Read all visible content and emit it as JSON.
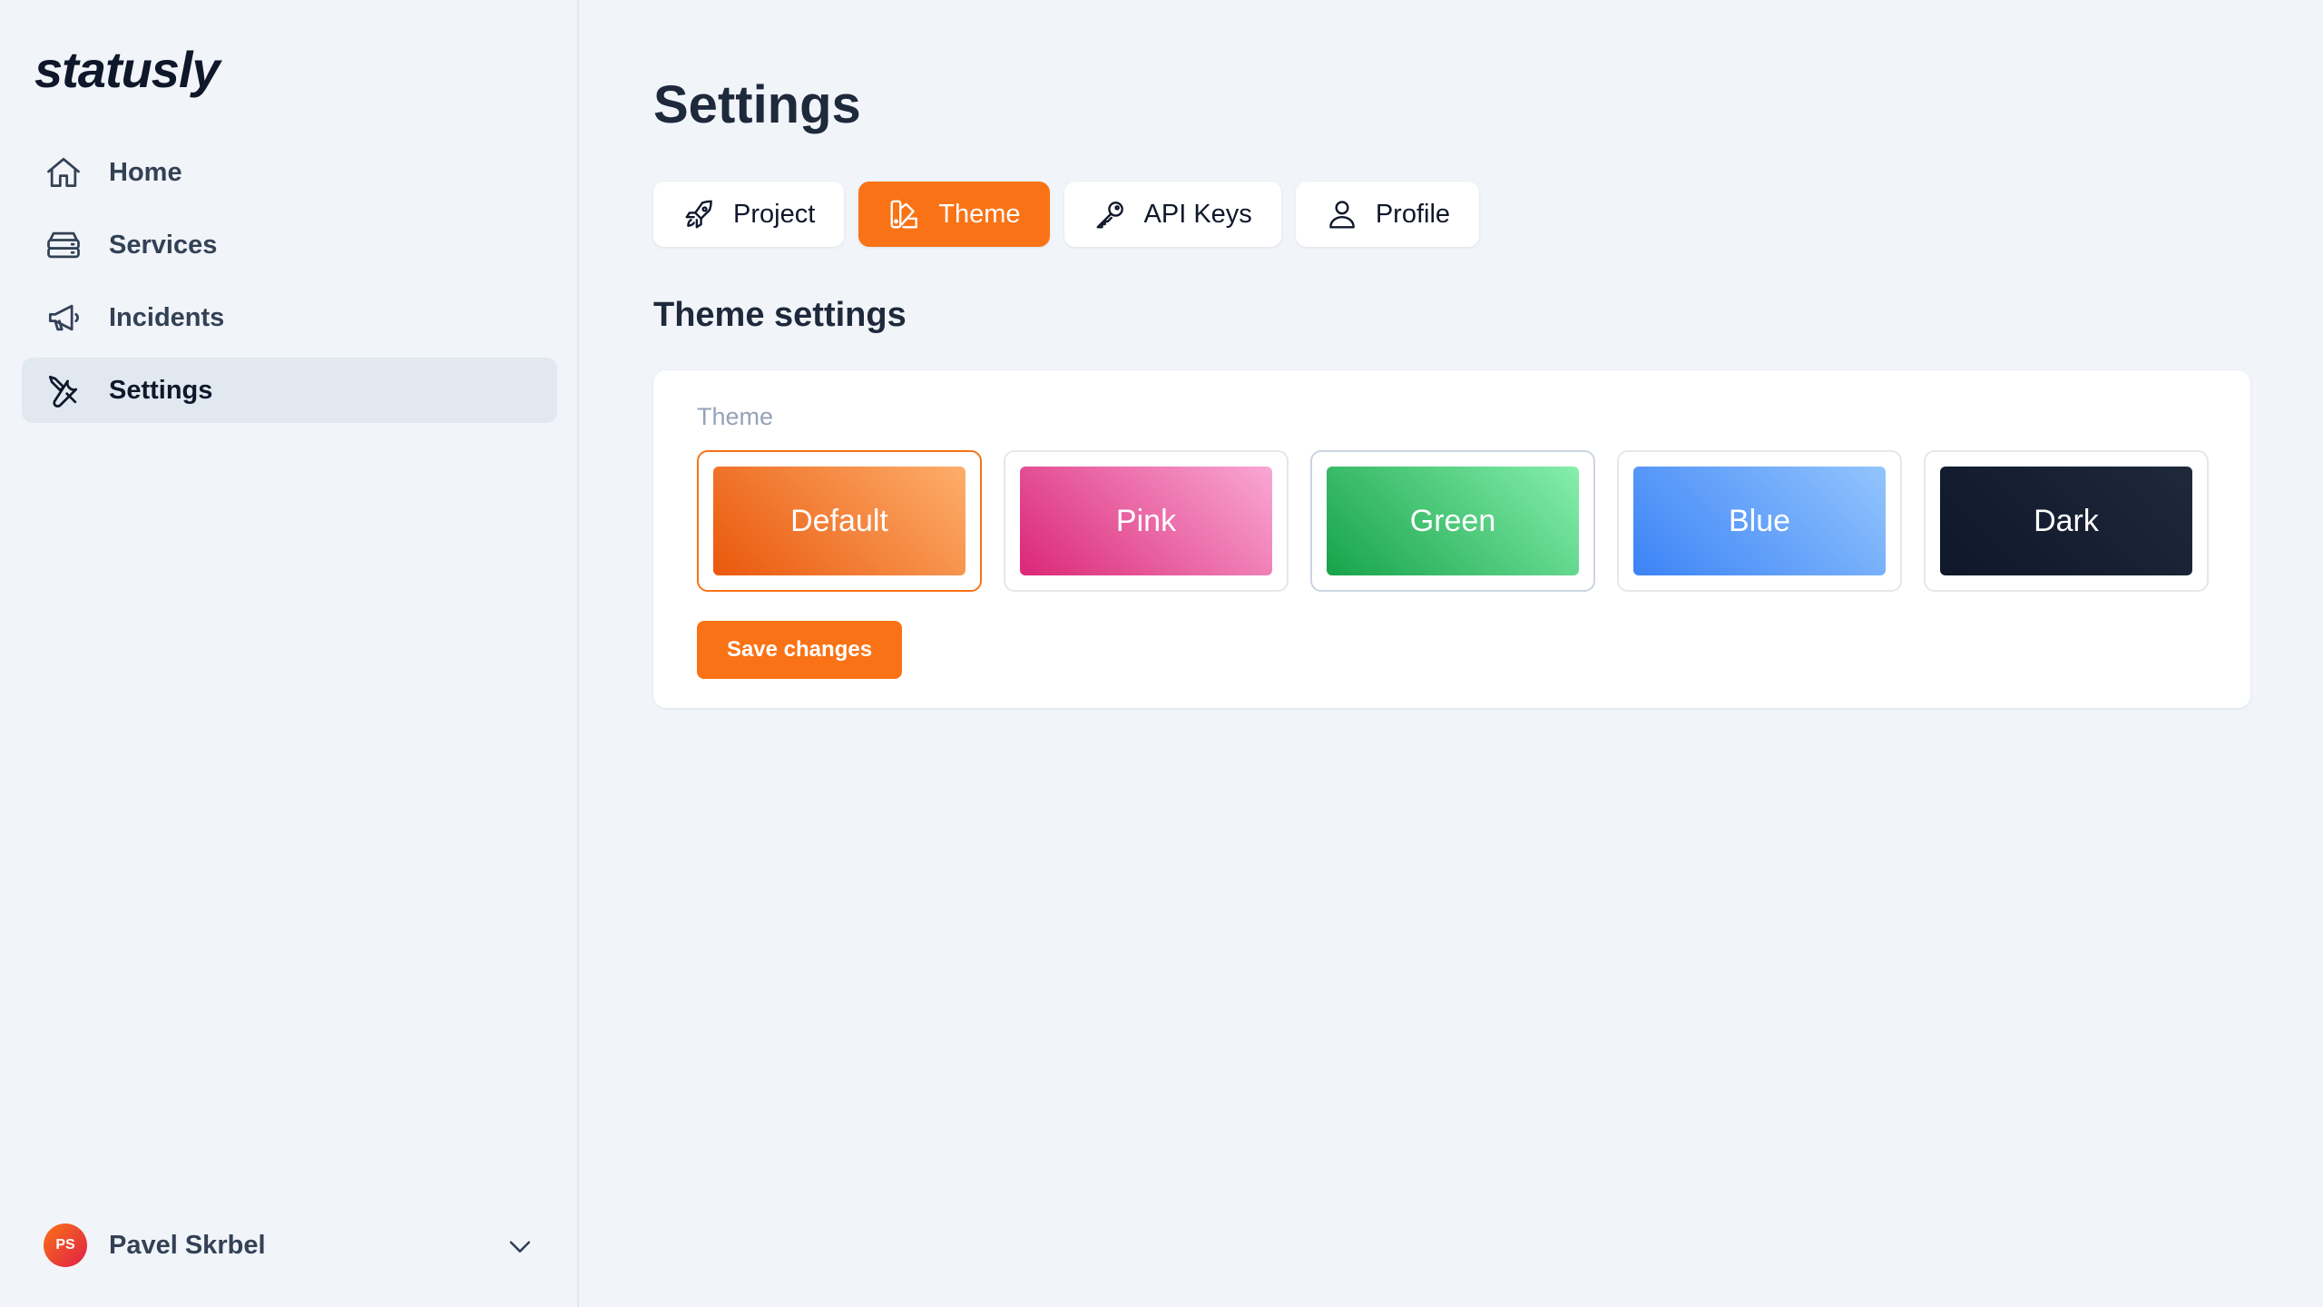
{
  "app": {
    "logo": "statusly"
  },
  "sidebar": {
    "items": [
      {
        "label": "Home",
        "icon": "home-icon"
      },
      {
        "label": "Services",
        "icon": "server-icon"
      },
      {
        "label": "Incidents",
        "icon": "megaphone-icon"
      },
      {
        "label": "Settings",
        "icon": "tools-icon",
        "active": true
      }
    ],
    "user": {
      "initials": "PS",
      "name": "Pavel Skrbel"
    }
  },
  "main": {
    "title": "Settings",
    "tabs": [
      {
        "label": "Project",
        "icon": "rocket-icon"
      },
      {
        "label": "Theme",
        "icon": "palette-icon",
        "active": true
      },
      {
        "label": "API Keys",
        "icon": "key-icon"
      },
      {
        "label": "Profile",
        "icon": "user-icon"
      }
    ],
    "section_title": "Theme settings",
    "theme_label": "Theme",
    "themes": [
      {
        "label": "Default",
        "selected": true
      },
      {
        "label": "Pink"
      },
      {
        "label": "Green"
      },
      {
        "label": "Blue"
      },
      {
        "label": "Dark"
      }
    ],
    "save_label": "Save changes"
  },
  "colors": {
    "accent": "#f97316",
    "background": "#f1f4f9",
    "text": "#1e293b"
  }
}
